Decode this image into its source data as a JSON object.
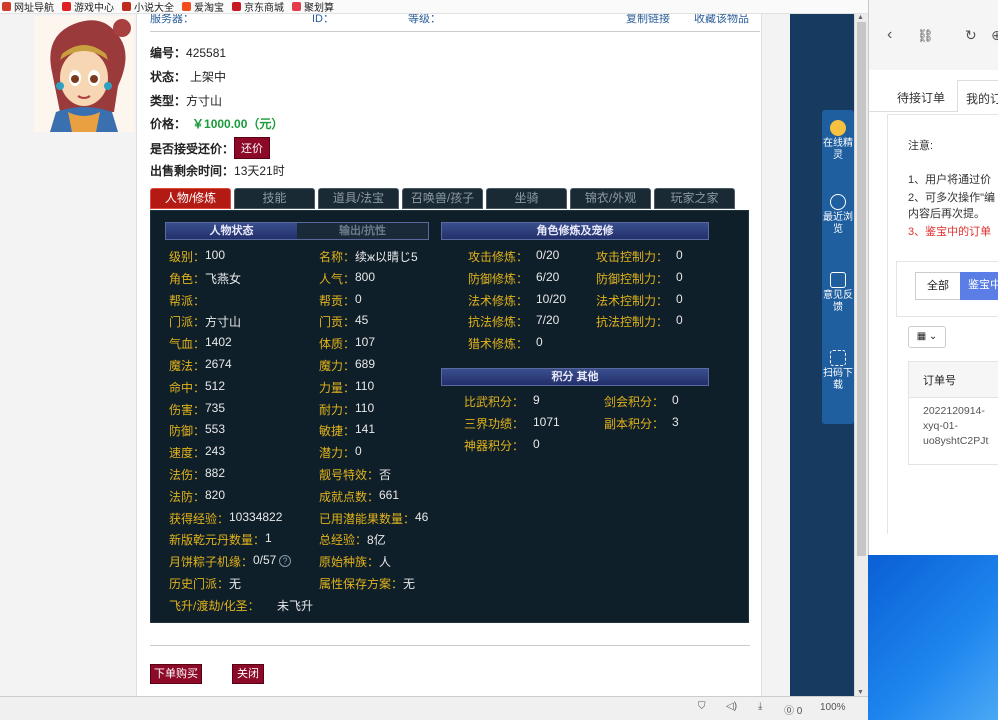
{
  "bookmarks": [
    {
      "icon": "globe-icon",
      "label": "网址导航",
      "color": "#d03a2a"
    },
    {
      "icon": "game-icon",
      "label": "游戏中心",
      "color": "#e02020"
    },
    {
      "icon": "novel-icon",
      "label": "小说大全",
      "color": "#c02a1a"
    },
    {
      "icon": "taobao-icon",
      "label": "爱淘宝",
      "color": "#f24d1a"
    },
    {
      "icon": "jd-icon",
      "label": "京东商城",
      "color": "#c81623"
    },
    {
      "icon": "juhuasuan-icon",
      "label": "聚划算",
      "color": "#e43c4a"
    }
  ],
  "header_strip": {
    "left": "服务器：",
    "middle": "ID：",
    "grade": "等级：",
    "fav_label": "复制链接",
    "collect_label": "收藏该物品"
  },
  "item": {
    "number_label": "编号：",
    "number_value": "425581",
    "status_label": "状态：",
    "status_value": "上架中",
    "type_label": "类型：",
    "type_value": "方寸山",
    "price_label": "价格：",
    "price_value": "￥1000.00（元）",
    "bargain_label": "是否接受还价：",
    "bargain_button": "还价",
    "remain_label": "出售剩余时间：",
    "remain_value": "13天21时"
  },
  "tabs": [
    {
      "label": "人物/修炼",
      "active": true
    },
    {
      "label": "技能",
      "active": false
    },
    {
      "label": "道具/法宝",
      "active": false
    },
    {
      "label": "召唤兽/孩子",
      "active": false
    },
    {
      "label": "坐骑",
      "active": false
    },
    {
      "label": "锦衣/外观",
      "active": false
    },
    {
      "label": "玩家之家",
      "active": false
    }
  ],
  "char_panel": {
    "header_active": "人物状态",
    "header_inactive": "输出/抗性",
    "left_col": [
      {
        "label": "级别：",
        "value": "100"
      },
      {
        "label": "角色：",
        "value": "飞燕女"
      },
      {
        "label": "帮派：",
        "value": ""
      },
      {
        "label": "门派：",
        "value": "方寸山"
      },
      {
        "label": "气血：",
        "value": "1402"
      },
      {
        "label": "魔法：",
        "value": "2674"
      },
      {
        "label": "命中：",
        "value": "512"
      },
      {
        "label": "伤害：",
        "value": "735"
      },
      {
        "label": "防御：",
        "value": "553"
      },
      {
        "label": "速度：",
        "value": "243"
      },
      {
        "label": "法伤：",
        "value": "882"
      },
      {
        "label": "法防：",
        "value": "820"
      },
      {
        "label": "获得经验：",
        "value": "10334822"
      },
      {
        "label": "新版乾元丹数量：",
        "value": "1"
      },
      {
        "label": "月饼粽子机缘：",
        "value": "0/57"
      },
      {
        "label": "历史门派：",
        "value": "无"
      },
      {
        "label": "飞升/渡劫/化圣：",
        "value": "未飞升"
      }
    ],
    "right_col": [
      {
        "label": "名称：",
        "value": "续ж以晴じ5"
      },
      {
        "label": "人气：",
        "value": "800"
      },
      {
        "label": "帮贡：",
        "value": "0"
      },
      {
        "label": "门贡：",
        "value": "45"
      },
      {
        "label": "体质：",
        "value": "107"
      },
      {
        "label": "魔力：",
        "value": "689"
      },
      {
        "label": "力量：",
        "value": "110"
      },
      {
        "label": "耐力：",
        "value": "110"
      },
      {
        "label": "敏捷：",
        "value": "141"
      },
      {
        "label": "潜力：",
        "value": "0"
      },
      {
        "label": "靓号特效：",
        "value": "否"
      },
      {
        "label": "成就点数：",
        "value": "661"
      },
      {
        "label": "已用潜能果数量：",
        "value": "46"
      },
      {
        "label": "总经验：",
        "value": "8亿"
      },
      {
        "label": "原始种族：",
        "value": "人"
      },
      {
        "label": "属性保存方案：",
        "value": "无"
      }
    ]
  },
  "cultivation": {
    "header": "角色修炼及宠修",
    "rows": [
      {
        "l1": "攻击修炼：",
        "v1": "0/20",
        "l2": "攻击控制力：",
        "v2": "0"
      },
      {
        "l1": "防御修炼：",
        "v1": "6/20",
        "l2": "防御控制力：",
        "v2": "0"
      },
      {
        "l1": "法术修炼：",
        "v1": "10/20",
        "l2": "法术控制力：",
        "v2": "0"
      },
      {
        "l1": "抗法修炼：",
        "v1": "7/20",
        "l2": "抗法控制力：",
        "v2": "0"
      },
      {
        "l1": "猎术修炼：",
        "v1": "0",
        "l2": "",
        "v2": ""
      }
    ]
  },
  "points": {
    "header": "积分 其他",
    "rows": [
      {
        "l1": "比武积分：",
        "v1": "9",
        "l2": "剑会积分：",
        "v2": "0"
      },
      {
        "l1": "三界功绩：",
        "v1": "1071",
        "l2": "副本积分：",
        "v2": "3"
      },
      {
        "l1": "神器积分：",
        "v1": "0",
        "l2": "",
        "v2": ""
      }
    ]
  },
  "buttons": {
    "buy": "下单购买",
    "close": "关闭"
  },
  "float_toolbar": [
    {
      "icon": "sprite-icon",
      "label": "在线精灵"
    },
    {
      "icon": "clock-icon",
      "label": "最近浏览"
    },
    {
      "icon": "feedback-icon",
      "label": "意见反馈"
    },
    {
      "icon": "scan-icon",
      "label": "扫码下载"
    }
  ],
  "side_panel": {
    "tab_pending": "待接订单",
    "tab_mine": "我的订",
    "note_title": "注意:",
    "note1": "1、用户将通过价",
    "note2": "2、可多次操作\"编",
    "note3": "内容后再次提。",
    "note4": "3、鉴宝中的订单",
    "filter_all": "全部",
    "filter_active": "鉴宝中",
    "col_header": "订单号",
    "order_id": [
      "2022120914-",
      "xyq-01-",
      "uo8yshtC2PJt"
    ]
  },
  "status": {
    "zoom": "100%",
    "count": "0"
  }
}
